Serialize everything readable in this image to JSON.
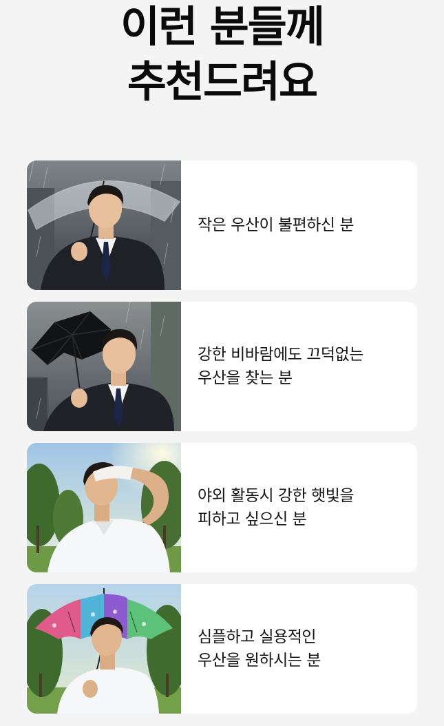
{
  "heading": {
    "line1": "이런 분들께",
    "line2": "추천드려요"
  },
  "cards": [
    {
      "photo_icon": "man-clear-umbrella-rain-icon",
      "lines": [
        "작은 우산이 불편하신 분"
      ]
    },
    {
      "photo_icon": "man-broken-umbrella-wind-icon",
      "lines": [
        "강한 비바람에도 끄덕없는",
        "우산을 찾는 분"
      ]
    },
    {
      "photo_icon": "man-shading-eyes-sun-icon",
      "lines": [
        "야외 활동시 강한 햇빛을",
        "피하고 싶으신 분"
      ]
    },
    {
      "photo_icon": "man-patterned-umbrella-park-icon",
      "lines": [
        "심플하고 실용적인",
        "우산을 원하시는 분"
      ]
    }
  ],
  "colors": {
    "background": "#f4f4f5",
    "card": "#ffffff",
    "text": "#161616"
  }
}
